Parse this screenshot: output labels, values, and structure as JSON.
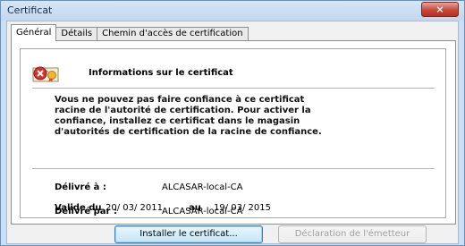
{
  "window": {
    "title": "Certificat",
    "close_label": "×"
  },
  "tabs": [
    {
      "label": "Général",
      "active": true
    },
    {
      "label": "Détails",
      "active": false
    },
    {
      "label": "Chemin d'accès de certification",
      "active": false
    }
  ],
  "info": {
    "title": "Informations sur le certificat",
    "warning_lines": [
      "Vous ne pouvez pas faire confiance à ce certificat",
      "racine de l'autorité de certification. Pour activer la",
      "confiance, installez ce certificat dans le magasin",
      "d'autorités de certification de la racine de confiance."
    ]
  },
  "fields": {
    "issued_to_label": "Délivré à :",
    "issued_to_value": "ALCASAR-local-CA",
    "issued_by_label": "Délivré par :",
    "issued_by_value": "ALCASAR-local-CA",
    "valid_label": "Valide du",
    "valid_from": "20/ 03/ 2011",
    "valid_to_label": "au",
    "valid_to": "19/ 03/ 2015"
  },
  "buttons": {
    "install": "Installer le certificat...",
    "issuer_statement": "Déclaration de l'émetteur"
  },
  "colors": {
    "close_button": "#c8483a",
    "titlebar": "#c9dff5"
  }
}
